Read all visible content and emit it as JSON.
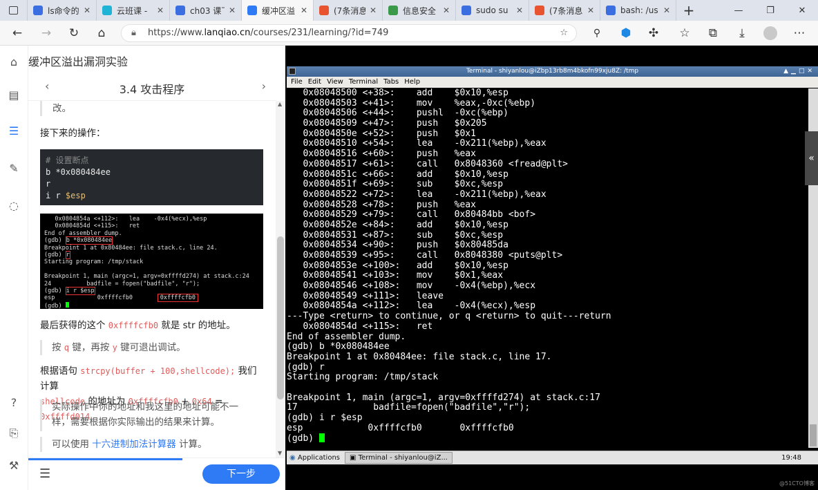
{
  "browser": {
    "tabs": [
      {
        "title": "ls命令的使",
        "favicon": "baidu-paw-icon",
        "color": "#3b6ee0"
      },
      {
        "title": "云班课 -",
        "favicon": "cloud-icon",
        "color": "#1fb3d6"
      },
      {
        "title": "ch03 课下",
        "favicon": "baidu-paw-icon",
        "color": "#3b6ee0"
      },
      {
        "title": "缓冲区溢",
        "favicon": "lanqiao-icon",
        "color": "#2f7af5",
        "active": true
      },
      {
        "title": "(7条消息",
        "favicon": "csdn-icon",
        "color": "#e8542f"
      },
      {
        "title": "信息安全",
        "favicon": "book-icon",
        "color": "#3a9a4a"
      },
      {
        "title": "sudo su",
        "favicon": "baidu-paw-icon",
        "color": "#3b6ee0"
      },
      {
        "title": "(7条消息",
        "favicon": "csdn-icon",
        "color": "#e8542f"
      },
      {
        "title": "bash: /us",
        "favicon": "baidu-paw-icon",
        "color": "#3b6ee0"
      }
    ],
    "new_tab_label": "+",
    "url_prefix": "https://www.",
    "url_domain": "lanqiao.cn",
    "url_path": "/courses/231/learning/?id=749"
  },
  "course": {
    "title": "缓冲区溢出漏洞实验",
    "lesson": "3.4 攻击程序",
    "prev_icon": "‹",
    "next_icon": "›",
    "quote_top": "改。",
    "next_ops": "接下来的操作：",
    "code_comment": "# 设置断点",
    "code_lines": [
      "b *0x080484ee",
      "r"
    ],
    "code_last_prefix": "i r ",
    "code_last_var": "$esp",
    "shot_lines": [
      "   0x0804854a <+112>:   lea    -0x4(%ecx),%esp",
      "   0x0804854d <+115>:   ret",
      "End of assembler dump.",
      "(gdb) b *0x080484ee",
      "Breakpoint 1 at 0x80484ee: file stack.c, line 24.",
      "(gdb) r",
      "Starting program: /tmp/stack",
      "",
      "Breakpoint 1, main (argc=1, argv=0xffffd274) at stack.c:24",
      "24          badfile = fopen(\"badfile\", \"r\");",
      "(gdb) i r $esp",
      "esp            0xffffcfb0       0xffffcfb0",
      "(gdb) "
    ],
    "final_a": "最后获得的这个 ",
    "final_code": "0xffffcfb0",
    "final_b": " 就是 str 的地址。",
    "quit_a": "按 ",
    "quit_q": "q",
    "quit_b": " 键，再按 ",
    "quit_y": "y",
    "quit_c": " 键可退出调试。",
    "calc_a": "根据语句 ",
    "calc_code1": "strcpy(buffer + 100,shellcode);",
    "calc_b": " 我们计算",
    "calc_code2": "shellcode",
    "calc_c": " 的地址为 ",
    "calc_code3": "0xffffcfb0",
    "calc_d": " + ",
    "calc_code4": "0x64",
    "calc_e": " = ",
    "calc_code5": "0xffffd014",
    "note": "实际操作中你的地址和我这里的地址可能不一样，需要根据你实际输出的结果来计算。",
    "calc_tool_a": "可以使用 ",
    "calc_tool_link": "十六进制加法计算器",
    "calc_tool_b": " 计算。",
    "next_button": "下一步",
    "progress_fraction": 0.6
  },
  "terminal": {
    "title": "Terminal - shiyanlou@iZbp13rb8m4bkofn99xju8Z: /tmp",
    "menu": [
      "File",
      "Edit",
      "View",
      "Terminal",
      "Tabs",
      "Help"
    ],
    "lines": [
      "   0x08048500 <+38>:    add    $0x10,%esp",
      "   0x08048503 <+41>:    mov    %eax,-0xc(%ebp)",
      "   0x08048506 <+44>:    pushl  -0xc(%ebp)",
      "   0x08048509 <+47>:    push   $0x205",
      "   0x0804850e <+52>:    push   $0x1",
      "   0x08048510 <+54>:    lea    -0x211(%ebp),%eax",
      "   0x08048516 <+60>:    push   %eax",
      "   0x08048517 <+61>:    call   0x8048360 <fread@plt>",
      "   0x0804851c <+66>:    add    $0x10,%esp",
      "   0x0804851f <+69>:    sub    $0xc,%esp",
      "   0x08048522 <+72>:    lea    -0x211(%ebp),%eax",
      "   0x08048528 <+78>:    push   %eax",
      "   0x08048529 <+79>:    call   0x80484bb <bof>",
      "   0x0804852e <+84>:    add    $0x10,%esp",
      "   0x08048531 <+87>:    sub    $0xc,%esp",
      "   0x08048534 <+90>:    push   $0x80485da",
      "   0x08048539 <+95>:    call   0x8048380 <puts@plt>",
      "   0x0804853e <+100>:   add    $0x10,%esp",
      "   0x08048541 <+103>:   mov    $0x1,%eax",
      "   0x08048546 <+108>:   mov    -0x4(%ebp),%ecx",
      "   0x08048549 <+111>:   leave",
      "   0x0804854a <+112>:   lea    -0x4(%ecx),%esp",
      "---Type <return> to continue, or q <return> to quit---return",
      "   0x0804854d <+115>:   ret",
      "End of assembler dump.",
      "(gdb) b *0x080484ee",
      "Breakpoint 1 at 0x80484ee: file stack.c, line 17.",
      "(gdb) r",
      "Starting program: /tmp/stack",
      "",
      "Breakpoint 1, main (argc=1, argv=0xffffd274) at stack.c:17",
      "17              badfile=fopen(\"badfile\",\"r\");",
      "(gdb) i r $esp",
      "esp            0xffffcfb0       0xffffcfb0",
      "(gdb) "
    ],
    "taskbar_apps": "Applications",
    "taskbar_task": "Terminal - shiyanlou@iZ...",
    "clock": "19:48",
    "collapse_icon": "«"
  },
  "watermark": "@51CTO博客"
}
